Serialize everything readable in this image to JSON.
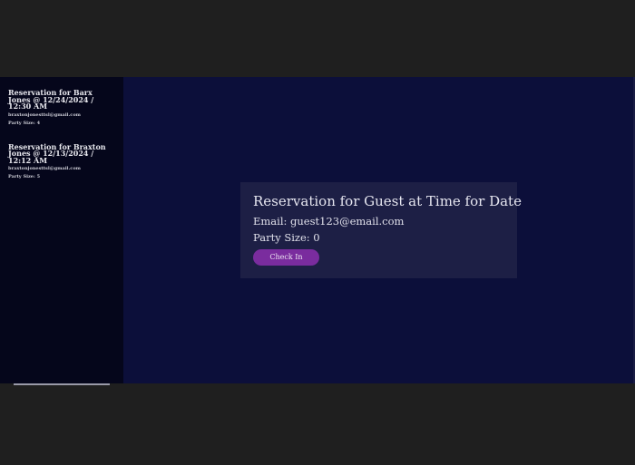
{
  "sidebar": {
    "reservations": [
      {
        "title": "Reservation for Barx Jones @ 12/24/2024 / 12:30 AM",
        "email": "braxtonjonesttsl@gmail.com",
        "party": "Party Size: 4"
      },
      {
        "title": "Reservation for Braxton Jones @ 12/13/2024 / 12:12 AM",
        "email": "braxtonjonesttsl@gmail.com",
        "party": "Party Size: 5"
      }
    ]
  },
  "detail": {
    "title": "Reservation for Guest at Time for Date",
    "email": "Email: guest123@email.com",
    "party": "Party Size: 0",
    "check_in_label": "Check In"
  },
  "colors": {
    "background": "#1f1f1f",
    "sidebar": "#05061b",
    "main": "#0c0f3a",
    "card": "#1d1f45",
    "button": "#7a2c9e"
  }
}
